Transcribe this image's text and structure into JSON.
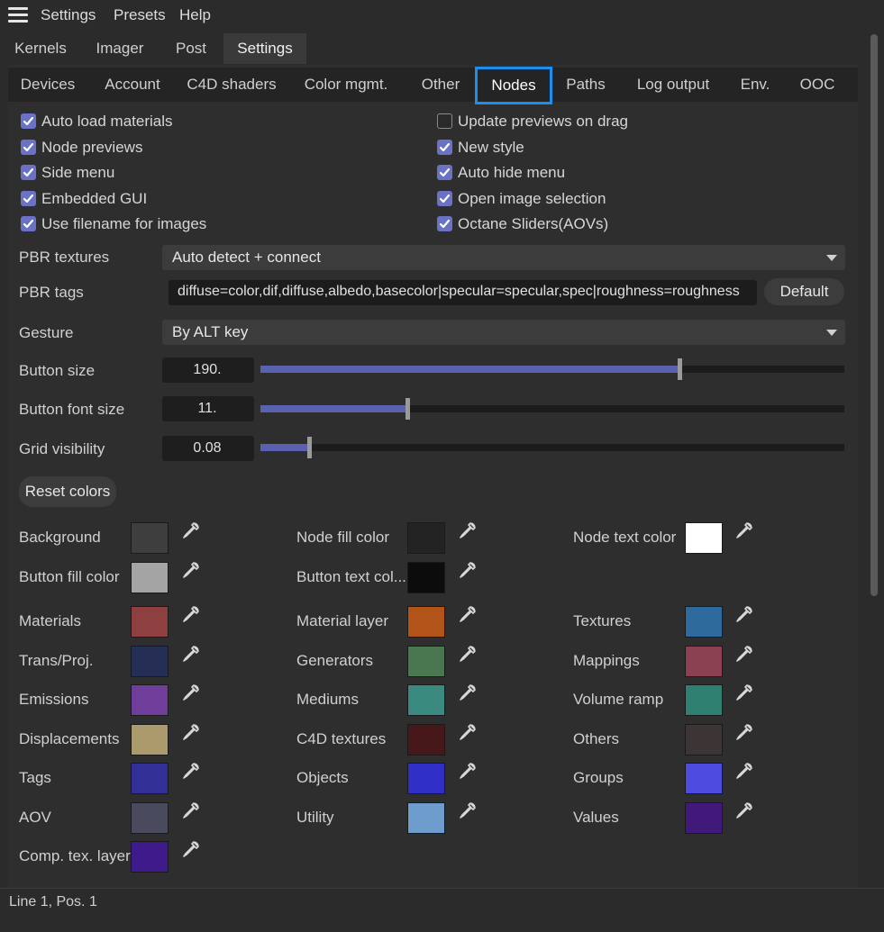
{
  "menubar": {
    "items": [
      "Settings",
      "Presets",
      "Help"
    ]
  },
  "tabs_main": {
    "items": [
      "Kernels",
      "Imager",
      "Post",
      "Settings"
    ],
    "active": 3
  },
  "tabs_sub": {
    "items": [
      "Devices",
      "Account",
      "C4D shaders",
      "Color mgmt.",
      "Other",
      "Nodes",
      "Paths",
      "Log output",
      "Env.",
      "OOC"
    ],
    "active": 5
  },
  "checkboxes": {
    "left": [
      {
        "label": "Auto load materials",
        "checked": true
      },
      {
        "label": "Node previews",
        "checked": true
      },
      {
        "label": "Side menu",
        "checked": true
      },
      {
        "label": "Embedded GUI",
        "checked": true
      },
      {
        "label": "Use filename for images",
        "checked": true
      }
    ],
    "right": [
      {
        "label": "Update previews on drag",
        "checked": false
      },
      {
        "label": "New style",
        "checked": true
      },
      {
        "label": "Auto hide menu",
        "checked": true
      },
      {
        "label": "Open image selection",
        "checked": true
      },
      {
        "label": "Octane Sliders(AOVs)",
        "checked": true
      }
    ]
  },
  "pbr_textures": {
    "label": "PBR textures",
    "value": "Auto detect + connect"
  },
  "pbr_tags": {
    "label": "PBR tags",
    "value": "diffuse=color,dif,diffuse,albedo,basecolor|specular=specular,spec|roughness=roughness",
    "default_label": "Default"
  },
  "gesture": {
    "label": "Gesture",
    "value": "By ALT key"
  },
  "button_size": {
    "label": "Button size",
    "value": "190.",
    "level": 0.717
  },
  "button_font_size": {
    "label": "Button font size",
    "value": "11.",
    "level": 0.252
  },
  "grid_visibility": {
    "label": "Grid visibility",
    "value": "0.08",
    "level": 0.084
  },
  "reset_colors": "Reset colors",
  "colors_row1": [
    [
      {
        "label": "Background",
        "color": "#3e3e3e"
      },
      {
        "label": "Node fill color",
        "color": "#232323"
      },
      {
        "label": "Node text color",
        "color": "#ffffff"
      }
    ],
    [
      {
        "label": "Button fill color",
        "color": "#a4a4a4"
      },
      {
        "label": "Button text col...",
        "color": "#0c0c0c"
      }
    ]
  ],
  "colors_row2": [
    [
      {
        "label": "Materials",
        "color": "#8e4040"
      },
      {
        "label": "Material layer",
        "color": "#b2531a"
      },
      {
        "label": "Textures",
        "color": "#2f6a9c"
      }
    ],
    [
      {
        "label": "Trans/Proj.",
        "color": "#252f56"
      },
      {
        "label": "Generators",
        "color": "#4a7750"
      },
      {
        "label": "Mappings",
        "color": "#8b4152"
      }
    ],
    [
      {
        "label": "Emissions",
        "color": "#6f3e9a"
      },
      {
        "label": "Mediums",
        "color": "#3a8a80"
      },
      {
        "label": "Volume ramp",
        "color": "#2f8070"
      }
    ],
    [
      {
        "label": "Displacements",
        "color": "#aa9a6c"
      },
      {
        "label": "C4D textures",
        "color": "#461819"
      },
      {
        "label": "Others",
        "color": "#3d3535"
      }
    ],
    [
      {
        "label": "Tags",
        "color": "#323096"
      },
      {
        "label": "Objects",
        "color": "#3030c8"
      },
      {
        "label": "Groups",
        "color": "#4e4ce0"
      }
    ],
    [
      {
        "label": "AOV",
        "color": "#4a4a5e"
      },
      {
        "label": "Utility",
        "color": "#6e9ccc"
      },
      {
        "label": "Values",
        "color": "#40197a"
      }
    ],
    [
      {
        "label": "Comp. tex. layer",
        "color": "#3e1a8a"
      }
    ]
  ],
  "status": "Line 1, Pos. 1"
}
